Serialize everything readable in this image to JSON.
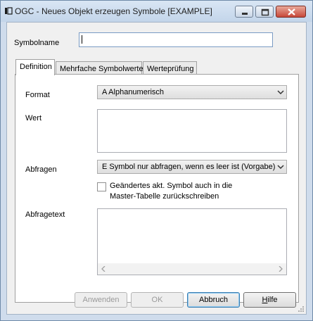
{
  "window": {
    "title": "OGC - Neues Objekt erzeugen Symbole [EXAMPLE]",
    "icons": [
      "system-menu-icon",
      "minimize-icon",
      "maximize-icon",
      "close-icon"
    ]
  },
  "symbolname": {
    "label": "Symbolname",
    "value": ""
  },
  "tabs": [
    {
      "label": "Definition",
      "active": true
    },
    {
      "label": "Mehrfache Symbolwerte",
      "active": false
    },
    {
      "label": "Werteprüfung",
      "active": false
    }
  ],
  "definition": {
    "format_label": "Format",
    "format_value": "A Alphanumerisch",
    "wert_label": "Wert",
    "wert_value": "",
    "abfragen_label": "Abfragen",
    "abfragen_value": "E Symbol nur abfragen, wenn es leer ist (Vorgabe)",
    "checkbox_line1": "Geändertes akt. Symbol auch in die",
    "checkbox_line2": "Master-Tabelle zurückschreiben",
    "checkbox_checked": false,
    "abfragetext_label": "Abfragetext",
    "abfragetext_value": ""
  },
  "buttons": {
    "apply": "Anwenden",
    "ok": "OK",
    "cancel": "Abbruch",
    "help_first": "H",
    "help_rest": "ilfe"
  }
}
